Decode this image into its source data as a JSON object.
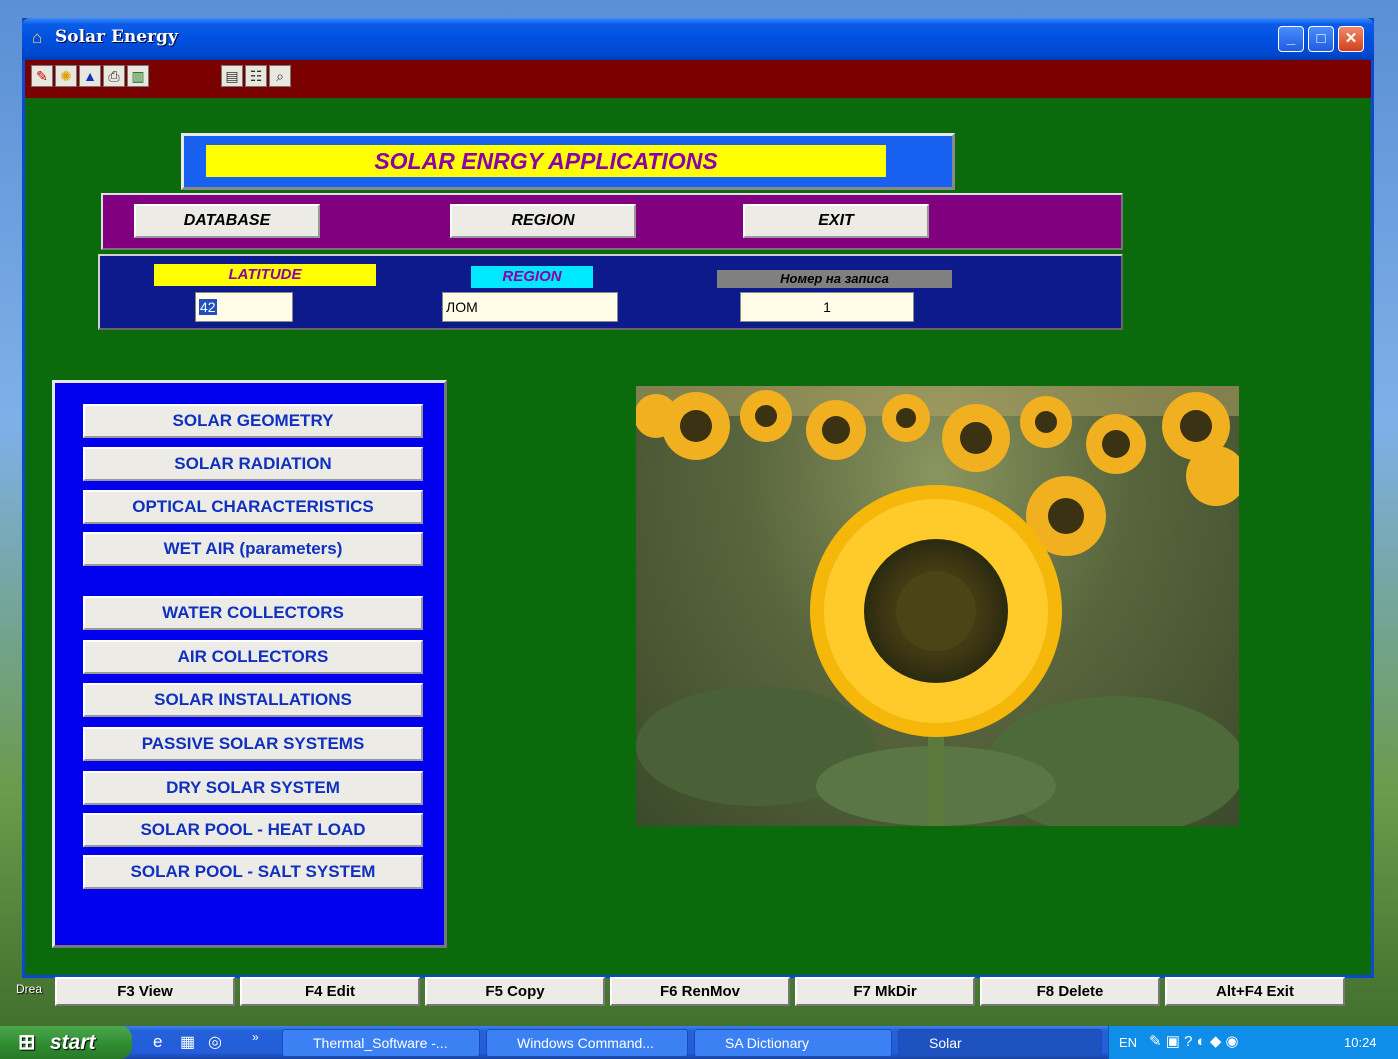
{
  "window": {
    "title": "Solar Energy",
    "controls": {
      "minimize": "_",
      "maximize": "□",
      "close": "✕"
    }
  },
  "toolbar": {
    "tools": [
      "pen-icon",
      "sun-icon",
      "compass-icon",
      "print-icon",
      "save-icon",
      "document-icon",
      "list-icon",
      "find-icon"
    ]
  },
  "banner": {
    "title": "SOLAR ENRGY APPLICATIONS"
  },
  "menu": {
    "database": "DATABASE",
    "region": "REGION",
    "exit": "EXIT"
  },
  "info": {
    "latitude_label": "LATITUDE",
    "latitude_value": "42",
    "region_label": "REGION",
    "region_value": "ЛОМ",
    "record_label": "Номер на записа",
    "record_value": "1"
  },
  "modules": [
    "SOLAR GEOMETRY",
    "SOLAR RADIATION",
    "OPTICAL CHARACTERISTICS",
    "WET AIR (parameters)",
    "WATER COLLECTORS",
    "AIR COLLECTORS",
    "SOLAR INSTALLATIONS",
    "PASSIVE SOLAR SYSTEMS",
    "DRY SOLAR SYSTEM",
    "SOLAR POOL - HEAT LOAD",
    "SOLAR POOL - SALT SYSTEM"
  ],
  "fkeys": [
    "F3 View",
    "F4 Edit",
    "F5 Copy",
    "F6 RenMov",
    "F7 MkDir",
    "F8 Delete",
    "Alt+F4 Exit"
  ],
  "desktop": {
    "label_drea": "Drea"
  },
  "taskbar": {
    "start": "start",
    "tasks": [
      "Thermal_Software -...",
      "Windows Command...",
      "SA Dictionary",
      "Solar"
    ],
    "tray_lang": "EN",
    "clock": "10:24"
  },
  "colors": {
    "window_bg": "#0b6a0b",
    "toolbar_bg": "#7a0000",
    "banner_yellow": "#ffff00",
    "menu_purple": "#800080",
    "panel_blue": "#0000ee",
    "module_text": "#1030c0"
  }
}
